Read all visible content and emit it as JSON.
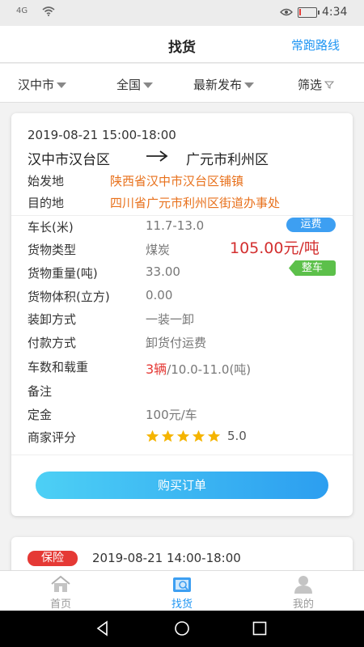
{
  "status": {
    "signal": "4G",
    "time": "4:34",
    "battery_level": 0.12
  },
  "header": {
    "title": "找货",
    "route_link": "常跑路线"
  },
  "filters": [
    {
      "label": "汉中市",
      "icon": "chevron-down-icon"
    },
    {
      "label": "全国",
      "icon": "chevron-down-icon"
    },
    {
      "label": "最新发布",
      "icon": "chevron-down-icon"
    },
    {
      "label": "筛选",
      "icon": "filter-icon"
    }
  ],
  "card1": {
    "datetime": "2019-08-21 15:00-18:00",
    "from": "汉中市汉台区",
    "to": "广元市利州区",
    "origin_label": "始发地",
    "origin_value": "陕西省汉中市汉台区铺镇",
    "dest_label": "目的地",
    "dest_value": "四川省广元市利州区街道办事处",
    "freight_tag": "运费",
    "price": "105.00元/吨",
    "type_tag": "整车",
    "rows": [
      {
        "label": "车长(米)",
        "value": "11.7-13.0"
      },
      {
        "label": "货物类型",
        "value": "煤炭"
      },
      {
        "label": "货物重量(吨)",
        "value": "33.00"
      },
      {
        "label": "货物体积(立方)",
        "value": "0.00"
      },
      {
        "label": "装卸方式",
        "value": "一装一卸"
      },
      {
        "label": "付款方式",
        "value": "卸货付运费"
      }
    ],
    "vehicles_label": "车数和载重",
    "vehicles_count": "3辆",
    "vehicles_weight": "/10.0-11.0(吨)",
    "remark_label": "备注",
    "remark_value": "",
    "deposit_label": "定金",
    "deposit_value": "100元/车",
    "rating_label": "商家评分",
    "rating_stars": 5,
    "rating_value": "5.0",
    "buy_button": "购买订单"
  },
  "card2": {
    "insurance_tag": "保险",
    "datetime": "2019-08-21 14:00-18:00"
  },
  "tabs": [
    {
      "label": "首页",
      "icon": "home-icon",
      "active": false
    },
    {
      "label": "找货",
      "icon": "find-goods-icon",
      "active": true
    },
    {
      "label": "我的",
      "icon": "profile-icon",
      "active": false
    }
  ],
  "colors": {
    "accent": "#2196f3",
    "orange": "#e8711c",
    "price_red": "#d32f2f",
    "green_tag": "#5cc04a",
    "star": "#f5b400"
  }
}
